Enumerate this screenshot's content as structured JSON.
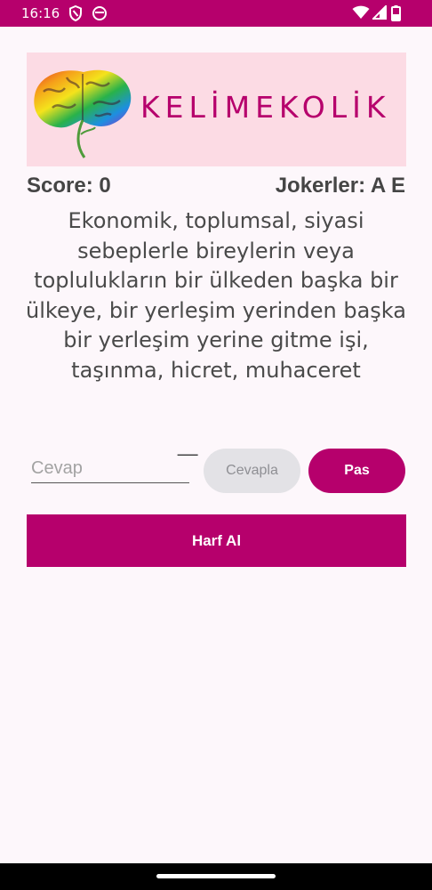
{
  "status_bar": {
    "time": "16:16",
    "left_icons": [
      "shield-icon",
      "face-icon"
    ],
    "right_icons": [
      "wifi-icon",
      "signal-icon",
      "battery-icon"
    ],
    "color": "#b6006c"
  },
  "logo": {
    "text": "KELİMEKOLİK",
    "icon": "brain-tree-icon",
    "background": "#fcdbe4"
  },
  "game": {
    "score_label": "Score: 0",
    "jokers_label": "Jokerler: A E",
    "question": "Ekonomik, toplumsal, siyasi sebeplerle bireylerin veya toplulukların bir ülkeden başka bir ülkeye, bir yerleşim yerinden başka bir yerleşim yerine gitme işi, taşınma, hicret, muhaceret",
    "hint": "_ _ _"
  },
  "answer": {
    "placeholder": "Cevap",
    "value": ""
  },
  "buttons": {
    "answer_label": "Cevapla",
    "pass_label": "Pas",
    "letter_label": "Harf Al"
  },
  "colors": {
    "accent": "#b6006c",
    "disabled_button": "#e3e2e6",
    "background": "#fdf7fb"
  }
}
